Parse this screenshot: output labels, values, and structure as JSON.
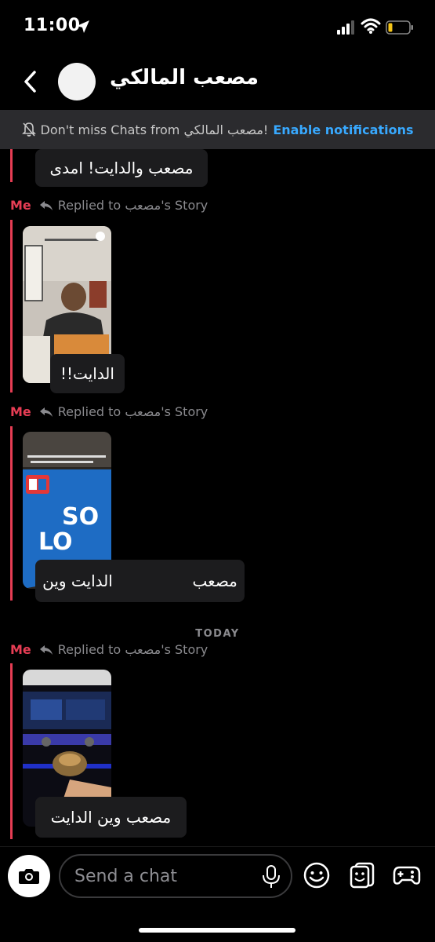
{
  "status_bar": {
    "time": "11:00",
    "icons": [
      "location-arrow-icon",
      "cellular-signal-icon",
      "wifi-icon",
      "battery-icon"
    ],
    "battery_color": "#f5c518"
  },
  "header": {
    "contact_name": "مصعب المالكي",
    "back_icon": "chevron-left-icon"
  },
  "banner": {
    "text": "Don't miss Chats from مصعب المالكي!",
    "link": "Enable notifications",
    "icon": "bell-slash-icon",
    "link_color": "#38a9ff"
  },
  "messages": [
    {
      "type": "text",
      "text": "مصعب والدايت! امدى"
    },
    {
      "type": "story_reply",
      "sender": "Me",
      "reply_label": "Replied to مصعب's Story",
      "text": "الدايت!!"
    },
    {
      "type": "story_reply",
      "sender": "Me",
      "reply_label": "Replied to مصعب's Story",
      "text": "مصعب                الدايت وين"
    },
    {
      "type": "date_divider",
      "text": "TODAY"
    },
    {
      "type": "story_reply",
      "sender": "Me",
      "reply_label": "Replied to مصعب's Story",
      "text": "مصعب وين الدايت"
    }
  ],
  "input": {
    "placeholder": "Send a chat",
    "icons": [
      "camera-icon",
      "microphone-icon",
      "smiley-icon",
      "stickers-icon",
      "game-controller-icon"
    ]
  },
  "colors": {
    "accent_red": "#e63d54",
    "bubble_bg": "#1c1c1e",
    "banner_bg": "#2b2b2e"
  }
}
